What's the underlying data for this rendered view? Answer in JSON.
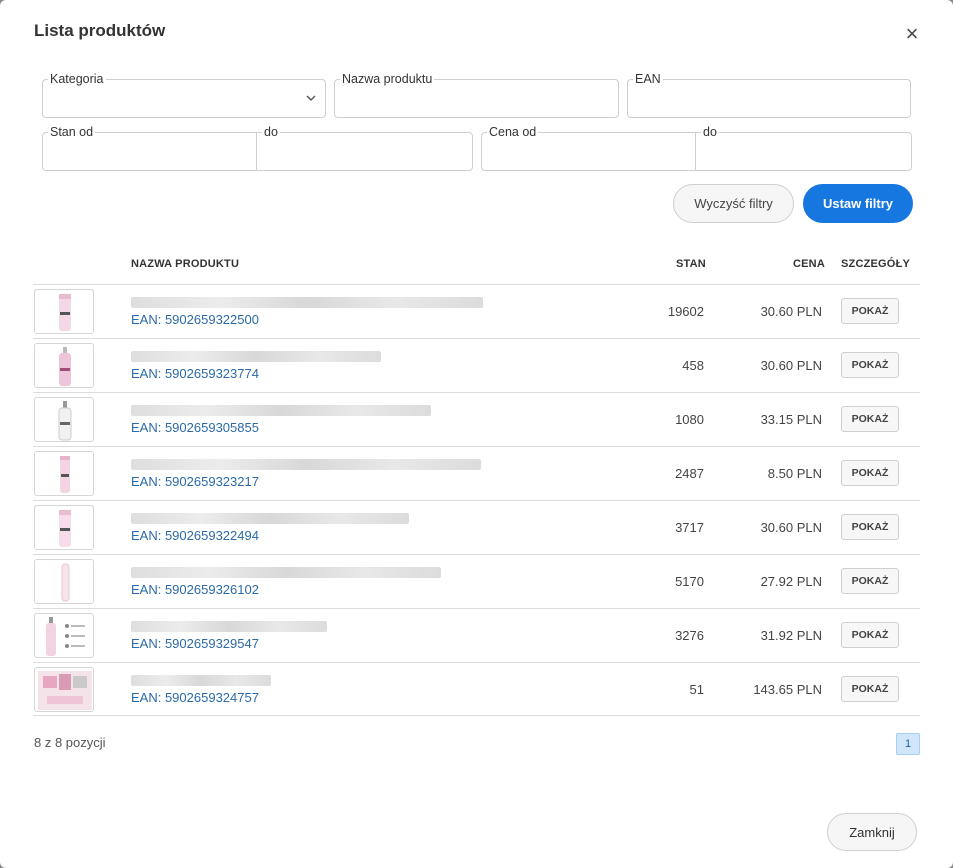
{
  "modal": {
    "title": "Lista produktów",
    "close_symbol": "×"
  },
  "filters": {
    "category_label": "Kategoria",
    "category_value": "",
    "product_name_label": "Nazwa produktu",
    "product_name_value": "",
    "ean_label": "EAN",
    "ean_value": "",
    "stock_from_label": "Stan od",
    "stock_from_value": "",
    "stock_to_label": "do",
    "stock_to_value": "",
    "price_from_label": "Cena od",
    "price_from_value": "",
    "price_to_label": "do",
    "price_to_value": "",
    "clear_label": "Wyczyść filtry",
    "apply_label": "Ustaw filtry"
  },
  "table": {
    "columns": {
      "name": "NAZWA PRODUKTU",
      "stock": "STAN",
      "price": "CENA",
      "details": "SZCZEGÓŁY"
    },
    "rows": [
      {
        "ean": "EAN: 5902659322500",
        "stock": "19602",
        "price": "30.60 PLN",
        "details_label": "POKAŻ",
        "thumb": "pink-tube"
      },
      {
        "ean": "EAN: 5902659323774",
        "stock": "458",
        "price": "30.60 PLN",
        "details_label": "POKAŻ",
        "thumb": "pink-bottle"
      },
      {
        "ean": "EAN: 5902659305855",
        "stock": "1080",
        "price": "33.15 PLN",
        "details_label": "POKAŻ",
        "thumb": "white-bottle"
      },
      {
        "ean": "EAN: 5902659323217",
        "stock": "2487",
        "price": "8.50 PLN",
        "details_label": "POKAŻ",
        "thumb": "pink-tube"
      },
      {
        "ean": "EAN: 5902659322494",
        "stock": "3717",
        "price": "30.60 PLN",
        "details_label": "POKAŻ",
        "thumb": "pink-tube"
      },
      {
        "ean": "EAN: 5902659326102",
        "stock": "5170",
        "price": "27.92 PLN",
        "details_label": "POKAŻ",
        "thumb": "slim-tube"
      },
      {
        "ean": "EAN: 5902659329547",
        "stock": "3276",
        "price": "31.92 PLN",
        "details_label": "POKAŻ",
        "thumb": "bottle-infographic"
      },
      {
        "ean": "EAN: 5902659324757",
        "stock": "51",
        "price": "143.65 PLN",
        "details_label": "POKAŻ",
        "thumb": "sos-set"
      }
    ]
  },
  "pagination": {
    "summary": "8 z 8 pozycji",
    "current_page": "1"
  },
  "footer": {
    "close_label": "Zamknij"
  },
  "colors": {
    "primary": "#1677e0",
    "link": "#2b6aa8",
    "page_active_bg": "#cfe6fb"
  }
}
